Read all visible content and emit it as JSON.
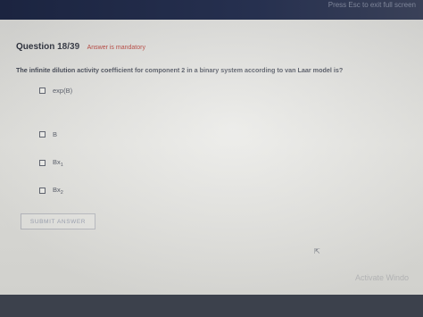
{
  "top_bar": {
    "hint": "Press Esc to exit full screen"
  },
  "question": {
    "title": "Question 18/39",
    "mandatory": "Answer is mandatory",
    "text": "The infinite dilution activity coefficient for component 2 in a binary system according to van Laar model is?"
  },
  "options": [
    {
      "main": "exp(B)",
      "sub": ""
    },
    {
      "main": "B",
      "sub": ""
    },
    {
      "main": "Bx",
      "sub": "1"
    },
    {
      "main": "Bx",
      "sub": "2"
    }
  ],
  "submit_label": "SUBMIT ANSWER",
  "watermark": "Activate Windo"
}
